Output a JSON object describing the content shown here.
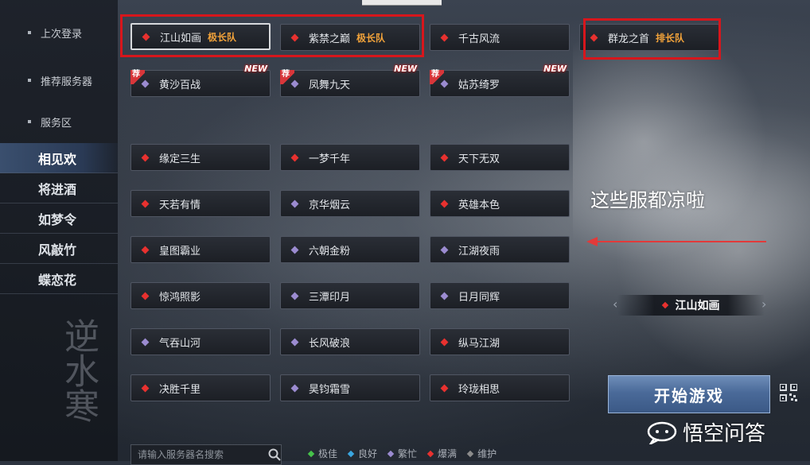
{
  "sidebar": {
    "links": [
      {
        "label": "上次登录"
      },
      {
        "label": "推荐服务器"
      },
      {
        "label": "服务区"
      }
    ],
    "servers": [
      {
        "label": "相见欢",
        "active": true
      },
      {
        "label": "将进酒"
      },
      {
        "label": "如梦令"
      },
      {
        "label": "风敲竹"
      },
      {
        "label": "蝶恋花"
      }
    ],
    "ink_text": "逆水寒"
  },
  "row1": [
    {
      "name": "江山如画",
      "tag": "极长队",
      "status": "red"
    },
    {
      "name": "紫禁之巅",
      "tag": "极长队",
      "status": "red"
    },
    {
      "name": "千古风流",
      "tag": "",
      "status": "red"
    },
    {
      "name": "群龙之首",
      "tag": "排长队",
      "status": "red"
    }
  ],
  "row2": [
    {
      "name": "黄沙百战",
      "status": "purple",
      "rec": "荐",
      "new": "NEW"
    },
    {
      "name": "凤舞九天",
      "status": "purple",
      "rec": "荐",
      "new": "NEW"
    },
    {
      "name": "姑苏绮罗",
      "status": "purple",
      "rec": "荐",
      "new": "NEW"
    }
  ],
  "grid": [
    [
      {
        "name": "缘定三生",
        "status": "red"
      },
      {
        "name": "一梦千年",
        "status": "red"
      },
      {
        "name": "天下无双",
        "status": "red"
      }
    ],
    [
      {
        "name": "天若有情",
        "status": "red"
      },
      {
        "name": "京华烟云",
        "status": "purple"
      },
      {
        "name": "英雄本色",
        "status": "red"
      }
    ],
    [
      {
        "name": "皇图霸业",
        "status": "red"
      },
      {
        "name": "六朝金粉",
        "status": "purple"
      },
      {
        "name": "江湖夜雨",
        "status": "purple"
      }
    ],
    [
      {
        "name": "惊鸿照影",
        "status": "red"
      },
      {
        "name": "三潭印月",
        "status": "purple"
      },
      {
        "name": "日月同辉",
        "status": "purple"
      }
    ],
    [
      {
        "name": "气吞山河",
        "status": "purple"
      },
      {
        "name": "长风破浪",
        "status": "purple"
      },
      {
        "name": "纵马江湖",
        "status": "red"
      }
    ],
    [
      {
        "name": "决胜千里",
        "status": "red"
      },
      {
        "name": "昊钧霜雪",
        "status": "purple"
      },
      {
        "name": "玲珑相思",
        "status": "red"
      }
    ]
  ],
  "annotation": "这些服都凉啦",
  "selected_server": "江山如画",
  "start_button": "开始游戏",
  "search": {
    "placeholder": "请输入服务器名搜索"
  },
  "legend": [
    {
      "label": "极佳",
      "color": "#46c24a"
    },
    {
      "label": "良好",
      "color": "#3aa6e0"
    },
    {
      "label": "繁忙",
      "color": "#9b8bd0"
    },
    {
      "label": "爆满",
      "color": "#e8312f"
    },
    {
      "label": "维护",
      "color": "#8c8c8c"
    }
  ],
  "watermark": "悟空问答",
  "colors": {
    "red": "#e8312f",
    "purple": "#9b8bd0",
    "tag": "#f1a23a",
    "highlight_box": "#d7161c"
  }
}
